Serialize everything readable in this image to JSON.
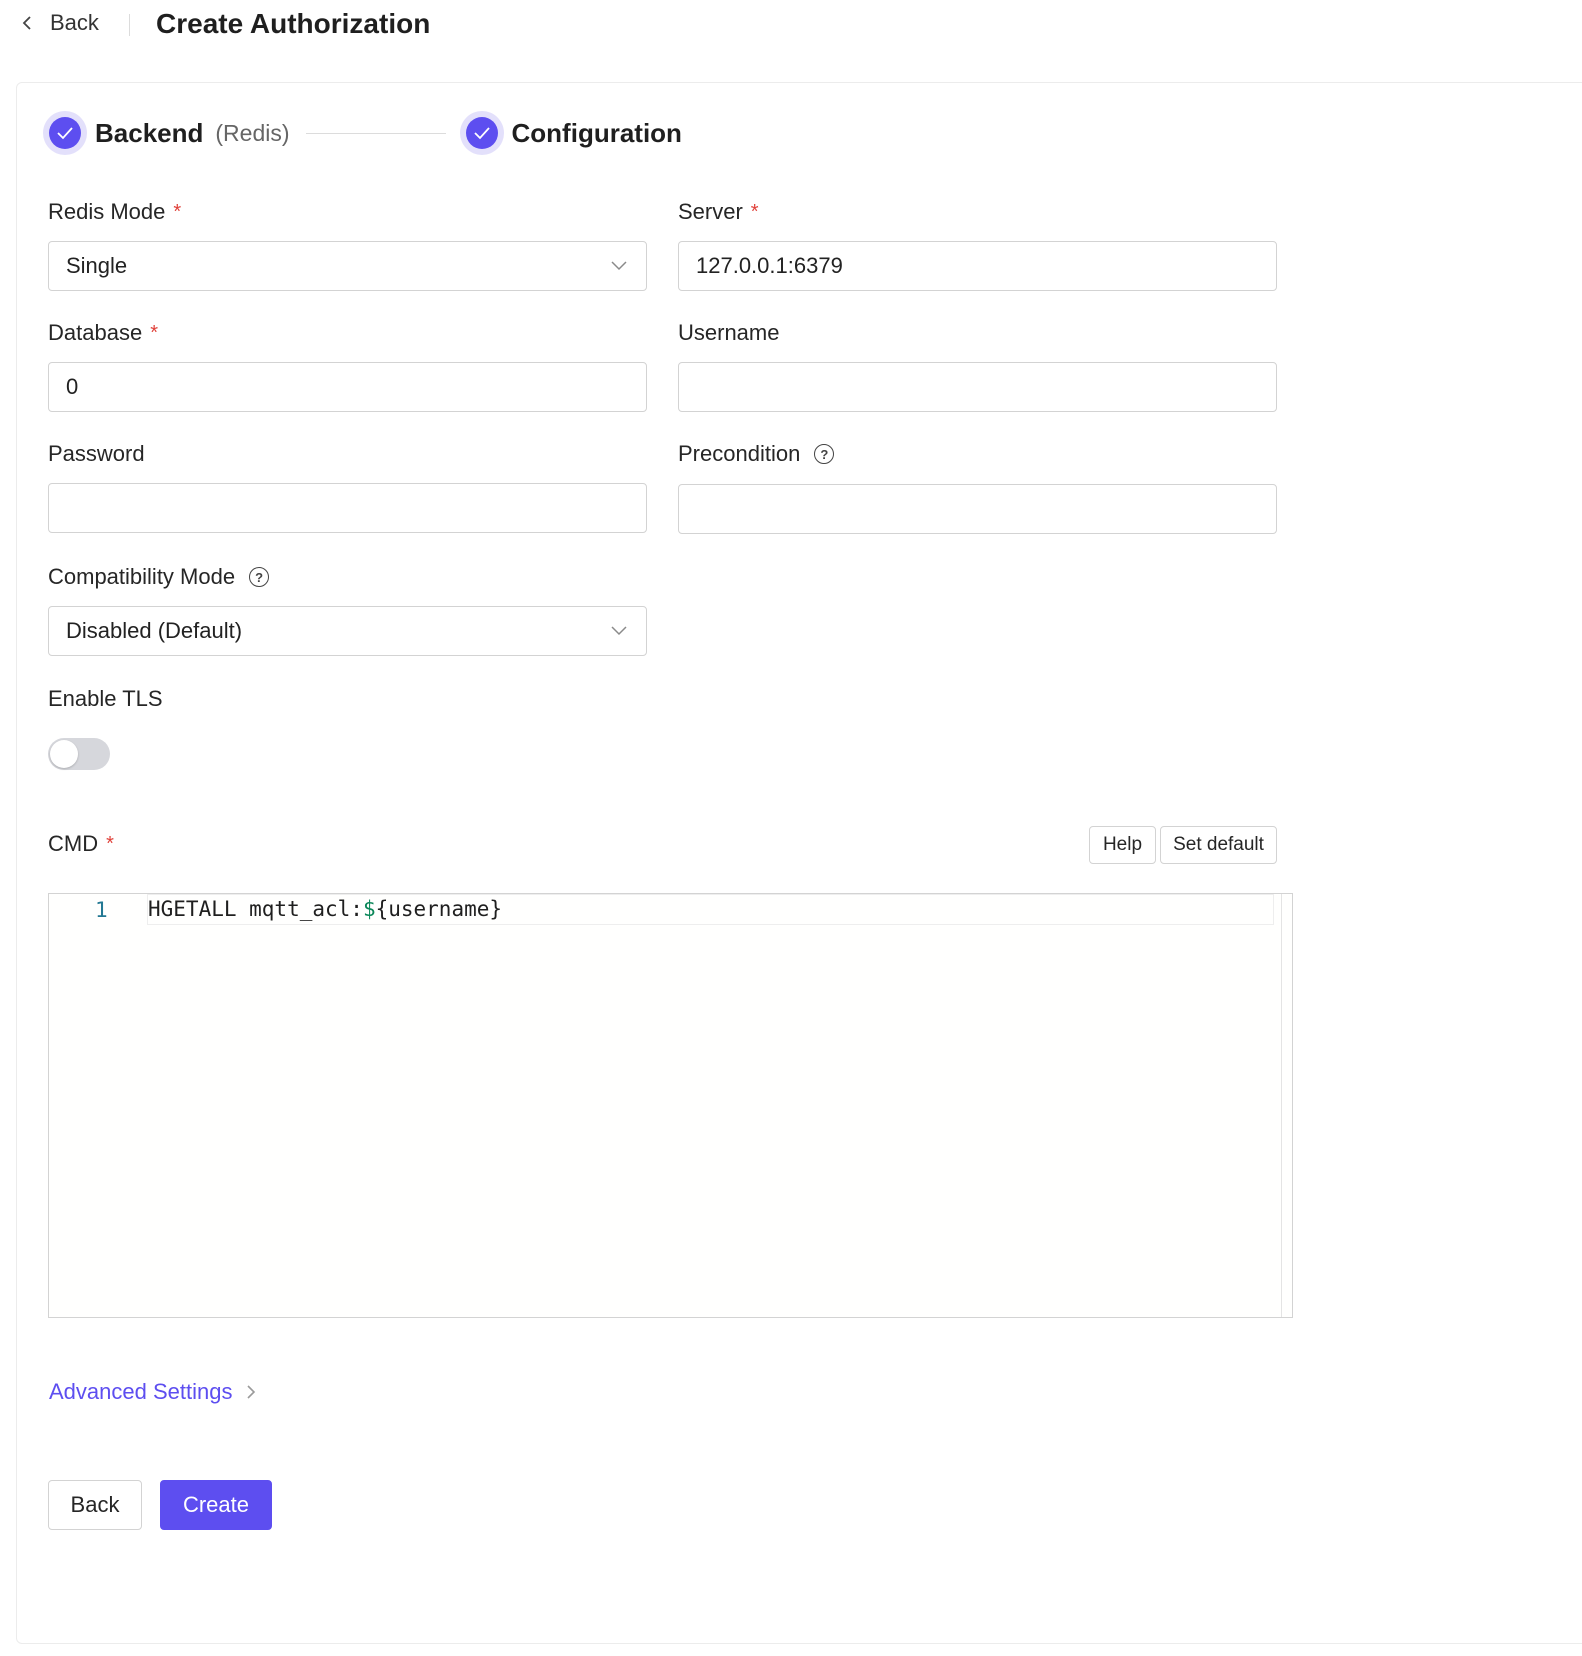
{
  "header": {
    "back_label": "Back",
    "title": "Create Authorization"
  },
  "steps": [
    {
      "title": "Backend",
      "subtitle": "(Redis)"
    },
    {
      "title": "Configuration",
      "subtitle": ""
    }
  ],
  "form": {
    "redis_mode": {
      "label": "Redis Mode",
      "required": "*",
      "value": "Single"
    },
    "server": {
      "label": "Server",
      "required": "*",
      "value": "127.0.0.1:6379"
    },
    "database": {
      "label": "Database",
      "required": "*",
      "value": "0"
    },
    "username": {
      "label": "Username",
      "value": ""
    },
    "password": {
      "label": "Password",
      "value": ""
    },
    "precondition": {
      "label": "Precondition",
      "value": ""
    },
    "compatibility_mode": {
      "label": "Compatibility Mode",
      "value": "Disabled (Default)"
    },
    "enable_tls": {
      "label": "Enable TLS",
      "enabled": false
    },
    "cmd": {
      "label": "CMD",
      "required": "*",
      "help_label": "Help",
      "set_default_label": "Set default",
      "line_number": "1",
      "code_prefix": "HGETALL mqtt_acl:",
      "code_var": "$",
      "code_suffix": "{username}"
    }
  },
  "advanced_settings_label": "Advanced Settings",
  "footer": {
    "back_label": "Back",
    "create_label": "Create"
  },
  "colors": {
    "primary": "#5d4ef0",
    "required": "#e0413a",
    "code_var": "#098658",
    "line_number": "#237893"
  }
}
